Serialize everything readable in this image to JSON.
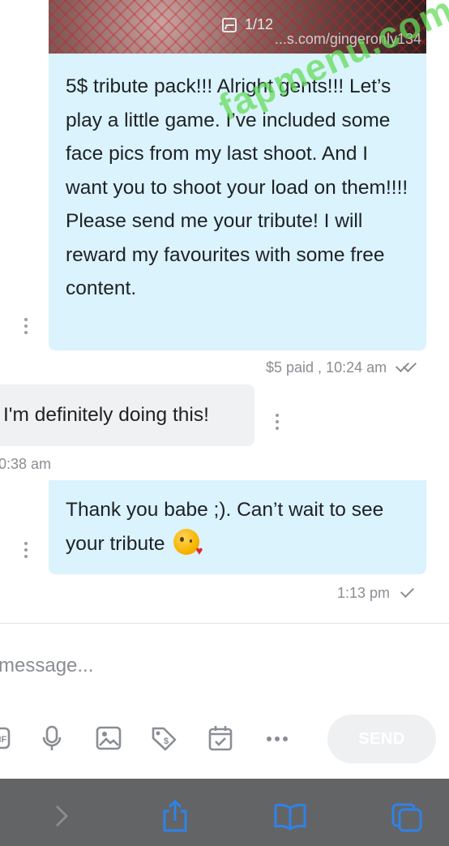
{
  "media": {
    "counter": "1/12",
    "url_watermark": "...s.com/gingeronly134"
  },
  "watermark": "fapmenu.com",
  "messages": [
    {
      "direction": "outgoing",
      "text": "5$ tribute pack!!! Alright gents!!! Let’s play a little game. I’ve included some face pics from my last shoot. And I want you to shoot your load on them!!!! Please send me your tribute! I will reward my favourites with some free content.",
      "meta": "$5 paid , 10:24 am",
      "read_status": "double-check"
    },
    {
      "direction": "incoming",
      "text": "I'm definitely doing this!",
      "meta": "0:38 am"
    },
    {
      "direction": "outgoing",
      "text": "Thank you babe ;). Can’t wait to see your tribute",
      "emoji": "kissing-face-with-heart",
      "meta": "1:13 pm",
      "read_status": "single-check"
    }
  ],
  "composer": {
    "placeholder": "message...",
    "send_label": "SEND",
    "tools": [
      "gif-icon",
      "microphone-icon",
      "image-icon",
      "price-tag-icon",
      "calendar-icon",
      "more-icon"
    ]
  },
  "browser_bar": {
    "icons": [
      "forward-arrow-icon",
      "share-icon",
      "bookmarks-icon",
      "tabs-icon"
    ],
    "accent": "#2f82e8"
  },
  "colors": {
    "outgoing_bubble": "#daf3fd",
    "incoming_bubble": "#f0f1f3",
    "send_button": "#eef0f2",
    "bottom_bar": "#636466"
  }
}
